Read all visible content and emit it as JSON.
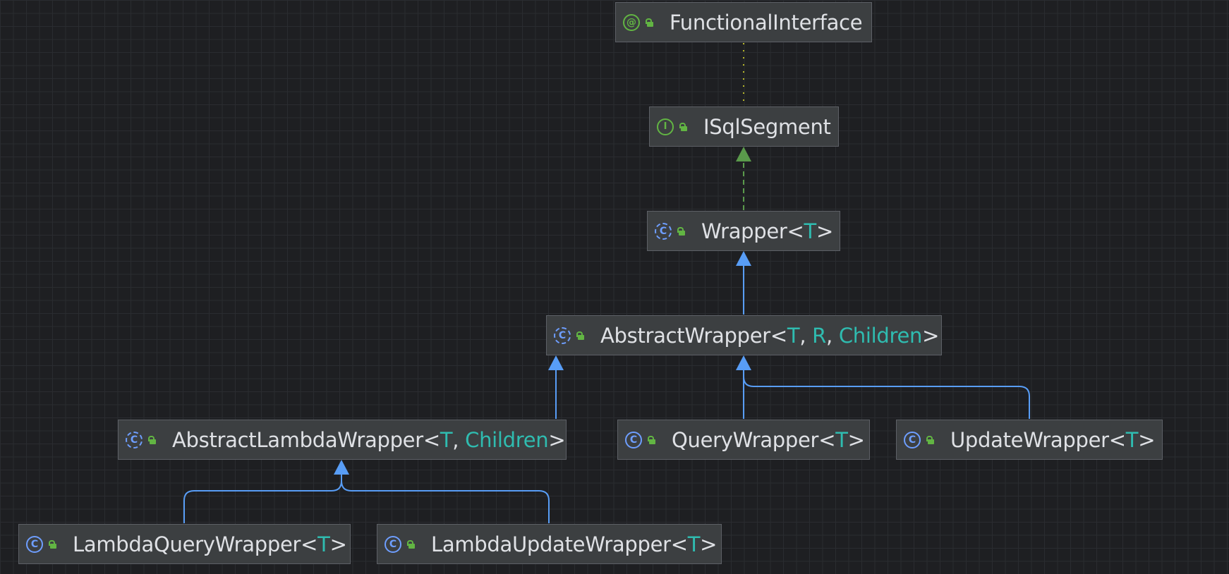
{
  "diagram": {
    "nodes": {
      "functional_interface": {
        "name": "FunctionalInterface",
        "kind": "annotation",
        "icon": "annotation-icon",
        "type_params": []
      },
      "isqlsegment": {
        "name": "ISqlSegment",
        "kind": "interface",
        "icon": "interface-icon",
        "type_params": []
      },
      "wrapper": {
        "name": "Wrapper",
        "kind": "abstract-class",
        "icon": "abstract-class-icon",
        "type_params": [
          "T"
        ]
      },
      "abstract_wrapper": {
        "name": "AbstractWrapper",
        "kind": "abstract-class",
        "icon": "abstract-class-icon",
        "type_params": [
          "T",
          "R",
          "Children"
        ]
      },
      "abstract_lambda_wrapper": {
        "name": "AbstractLambdaWrapper",
        "kind": "abstract-class",
        "icon": "abstract-class-icon",
        "type_params": [
          "T",
          "Children"
        ]
      },
      "query_wrapper": {
        "name": "QueryWrapper",
        "kind": "class",
        "icon": "class-icon",
        "type_params": [
          "T"
        ]
      },
      "update_wrapper": {
        "name": "UpdateWrapper",
        "kind": "class",
        "icon": "class-icon",
        "type_params": [
          "T"
        ]
      },
      "lambda_query_wrapper": {
        "name": "LambdaQueryWrapper",
        "kind": "class",
        "icon": "class-icon",
        "type_params": [
          "T"
        ]
      },
      "lambda_update_wrapper": {
        "name": "LambdaUpdateWrapper",
        "kind": "class",
        "icon": "class-icon",
        "type_params": [
          "T"
        ]
      }
    },
    "edges": [
      {
        "from": "isqlsegment",
        "to": "functional_interface",
        "type": "annotated"
      },
      {
        "from": "wrapper",
        "to": "isqlsegment",
        "type": "implements"
      },
      {
        "from": "abstract_wrapper",
        "to": "wrapper",
        "type": "extends"
      },
      {
        "from": "abstract_lambda_wrapper",
        "to": "abstract_wrapper",
        "type": "extends"
      },
      {
        "from": "query_wrapper",
        "to": "abstract_wrapper",
        "type": "extends"
      },
      {
        "from": "update_wrapper",
        "to": "abstract_wrapper",
        "type": "extends"
      },
      {
        "from": "lambda_query_wrapper",
        "to": "abstract_lambda_wrapper",
        "type": "extends"
      },
      {
        "from": "lambda_update_wrapper",
        "to": "abstract_lambda_wrapper",
        "type": "extends"
      }
    ],
    "colors": {
      "background": "#1e1f22",
      "node_fill": "#3c3f41",
      "extends_edge": "#589df6",
      "implements_edge": "#5a9a4b",
      "annotation_edge": "#b5b52a",
      "type_param": "#2fbcb0",
      "text": "#dfe1e5"
    }
  }
}
